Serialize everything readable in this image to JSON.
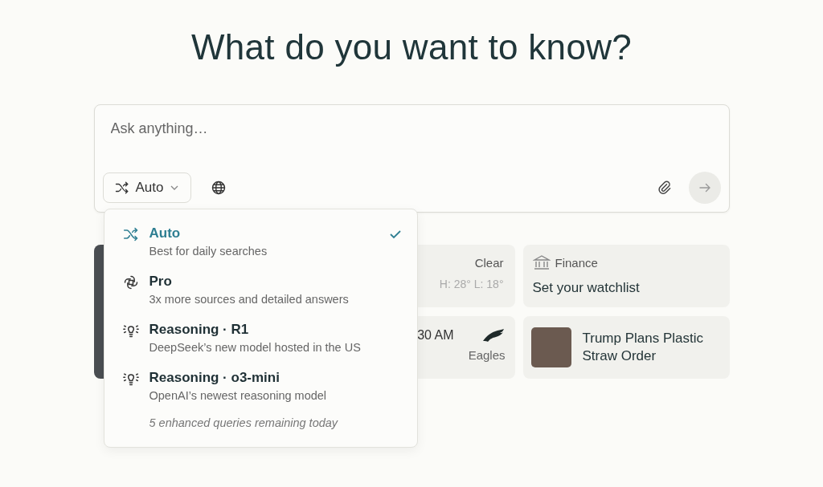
{
  "heading": "What do you want to know?",
  "search": {
    "placeholder": "Ask anything…",
    "mode_button": "Auto"
  },
  "mode_menu": {
    "options": [
      {
        "kind": "shuffle",
        "label": "Auto",
        "description": "Best for daily searches",
        "selected": true
      },
      {
        "kind": "spiral",
        "label": "Pro",
        "description": "3x more sources and detailed answers",
        "selected": false
      },
      {
        "kind": "bulb",
        "label": "Reasoning · R1",
        "description": "DeepSeek’s new model hosted in the US",
        "selected": false
      },
      {
        "kind": "bulb",
        "label": "Reasoning · o3-mini",
        "description": "OpenAI’s newest reasoning model",
        "selected": false
      }
    ],
    "footnote": "5 enhanced queries remaining today"
  },
  "cards": [
    {
      "kind": "photo"
    },
    {
      "kind": "weather",
      "condition": "Clear",
      "range": "H: 28° L: 18°"
    },
    {
      "kind": "finance",
      "title": "Finance",
      "prompt": "Set your watchlist"
    },
    {
      "kind": "sports",
      "time": "30 AM",
      "team": "Eagles"
    },
    {
      "kind": "news",
      "headline": "Trump Plans Plastic Straw Order"
    }
  ]
}
